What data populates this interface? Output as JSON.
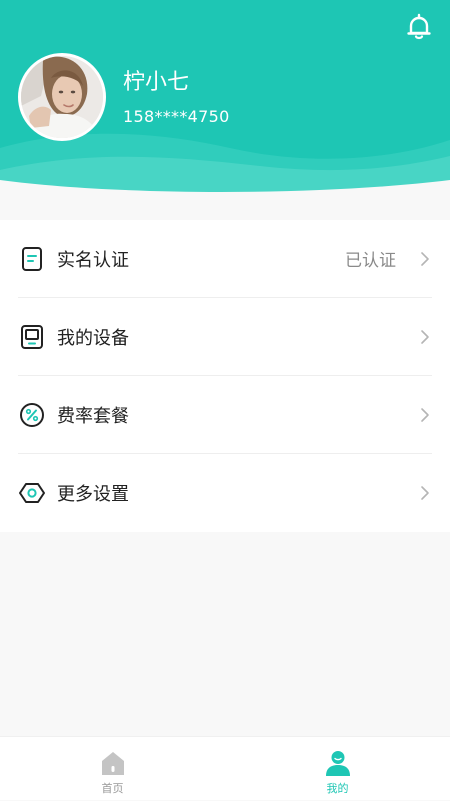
{
  "colors": {
    "accent": "#1ec6b4",
    "text_primary": "#222222",
    "text_secondary": "#8a8a8a",
    "tab_inactive": "#999999"
  },
  "header": {
    "notification_icon": "bell-icon"
  },
  "profile": {
    "name": "柠小七",
    "phone": "158****4750"
  },
  "menu": {
    "items": [
      {
        "label": "实名认证",
        "status": "已认证",
        "icon": "id-document-icon"
      },
      {
        "label": "我的设备",
        "status": "",
        "icon": "device-icon"
      },
      {
        "label": "费率套餐",
        "status": "",
        "icon": "percent-icon"
      },
      {
        "label": "更多设置",
        "status": "",
        "icon": "hexagon-settings-icon"
      }
    ]
  },
  "tabbar": {
    "tabs": [
      {
        "label": "首页",
        "icon": "home-icon",
        "active": false
      },
      {
        "label": "我的",
        "icon": "user-icon",
        "active": true
      }
    ]
  }
}
